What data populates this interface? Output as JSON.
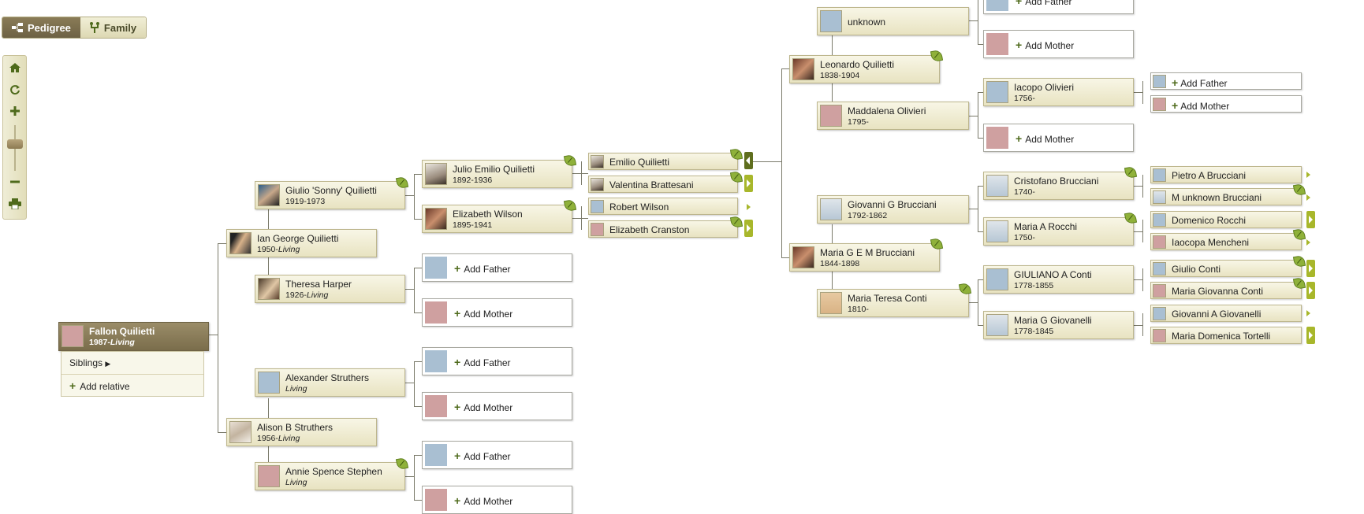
{
  "toolbar": {
    "pedigree_label": "Pedigree",
    "family_label": "Family"
  },
  "root": {
    "name": "Fallon Quilietti",
    "birth": "1987-",
    "living": "Living",
    "menu": {
      "siblings": "Siblings",
      "add_relative": "Add relative"
    }
  },
  "persons": {
    "ian": {
      "name": "Ian George Quilietti",
      "birth": "1950-",
      "living": "Living"
    },
    "alison": {
      "name": "Alison B Struthers",
      "birth": "1956-",
      "living": "Living"
    },
    "giulio": {
      "name": "Giulio 'Sonny' Quilietti",
      "dates": "1919-1973"
    },
    "theresa": {
      "name": "Theresa Harper",
      "birth": "1926-",
      "living": "Living"
    },
    "alexander": {
      "name": "Alexander Struthers",
      "living": "Living"
    },
    "annie": {
      "name": "Annie Spence Stephen",
      "living": "Living"
    },
    "julio": {
      "name": "Julio Emilio Quilietti",
      "dates": "1892-1936"
    },
    "elizabeth": {
      "name": "Elizabeth Wilson",
      "dates": "1895-1941"
    },
    "emilio": {
      "name": "Emilio Quilietti"
    },
    "valentina": {
      "name": "Valentina Brattesani"
    },
    "robert": {
      "name": "Robert Wilson"
    },
    "ecranston": {
      "name": "Elizabeth Cranston"
    },
    "leonardo": {
      "name": "Leonardo Quilietti",
      "dates": "1838-1904"
    },
    "mariagem": {
      "name": "Maria G E M Brucciani",
      "dates": "1844-1898"
    },
    "unknown": {
      "name": "unknown"
    },
    "maddalena": {
      "name": "Maddalena Olivieri",
      "dates": "1795-"
    },
    "giovannig": {
      "name": "Giovanni G Brucciani",
      "dates": "1792-1862"
    },
    "mariateresa": {
      "name": "Maria Teresa Conti",
      "dates": "1810-"
    },
    "iacopo": {
      "name": "Iacopo Olivieri",
      "dates": "1756-"
    },
    "cristofano": {
      "name": "Cristofano Brucciani",
      "dates": "1740-"
    },
    "mariaa": {
      "name": "Maria A Rocchi",
      "dates": "1750-"
    },
    "giuliano": {
      "name": "GIULIANO A Conti",
      "dates": "1778-1855"
    },
    "mariag": {
      "name": "Maria G Giovanelli",
      "dates": "1778-1845"
    },
    "pietro": {
      "name": "Pietro A Brucciani"
    },
    "munknown": {
      "name": "M unknown Brucciani"
    },
    "domenico": {
      "name": "Domenico Rocchi"
    },
    "iaocopa": {
      "name": "Iaocopa Mencheni"
    },
    "giulioc": {
      "name": "Giulio Conti"
    },
    "mariagc": {
      "name": "Maria Giovanna Conti"
    },
    "giovannia": {
      "name": "Giovanni A Giovanelli"
    },
    "mariadt": {
      "name": "Maria Domenica Tortelli"
    }
  },
  "labels": {
    "add_father": "Add Father",
    "add_mother": "Add Mother"
  },
  "icons": {
    "pedigree": "pedigree-icon",
    "family": "family-icon",
    "home": "home-icon",
    "refresh": "refresh-icon",
    "zoom_in": "zoom-in-icon",
    "zoom_out": "zoom-out-icon",
    "print": "print-icon",
    "hint": "leaf-hint-icon"
  },
  "colors": {
    "card_bg": "#efebcd",
    "selected": "#7a6d4b",
    "accent_green": "#4e6a1b",
    "expand_arrow": "#a8b72b",
    "male_silhouette": "#a9bfd2",
    "female_silhouette": "#cfa0a0"
  },
  "zoom": {
    "level_fraction": 0.6
  }
}
